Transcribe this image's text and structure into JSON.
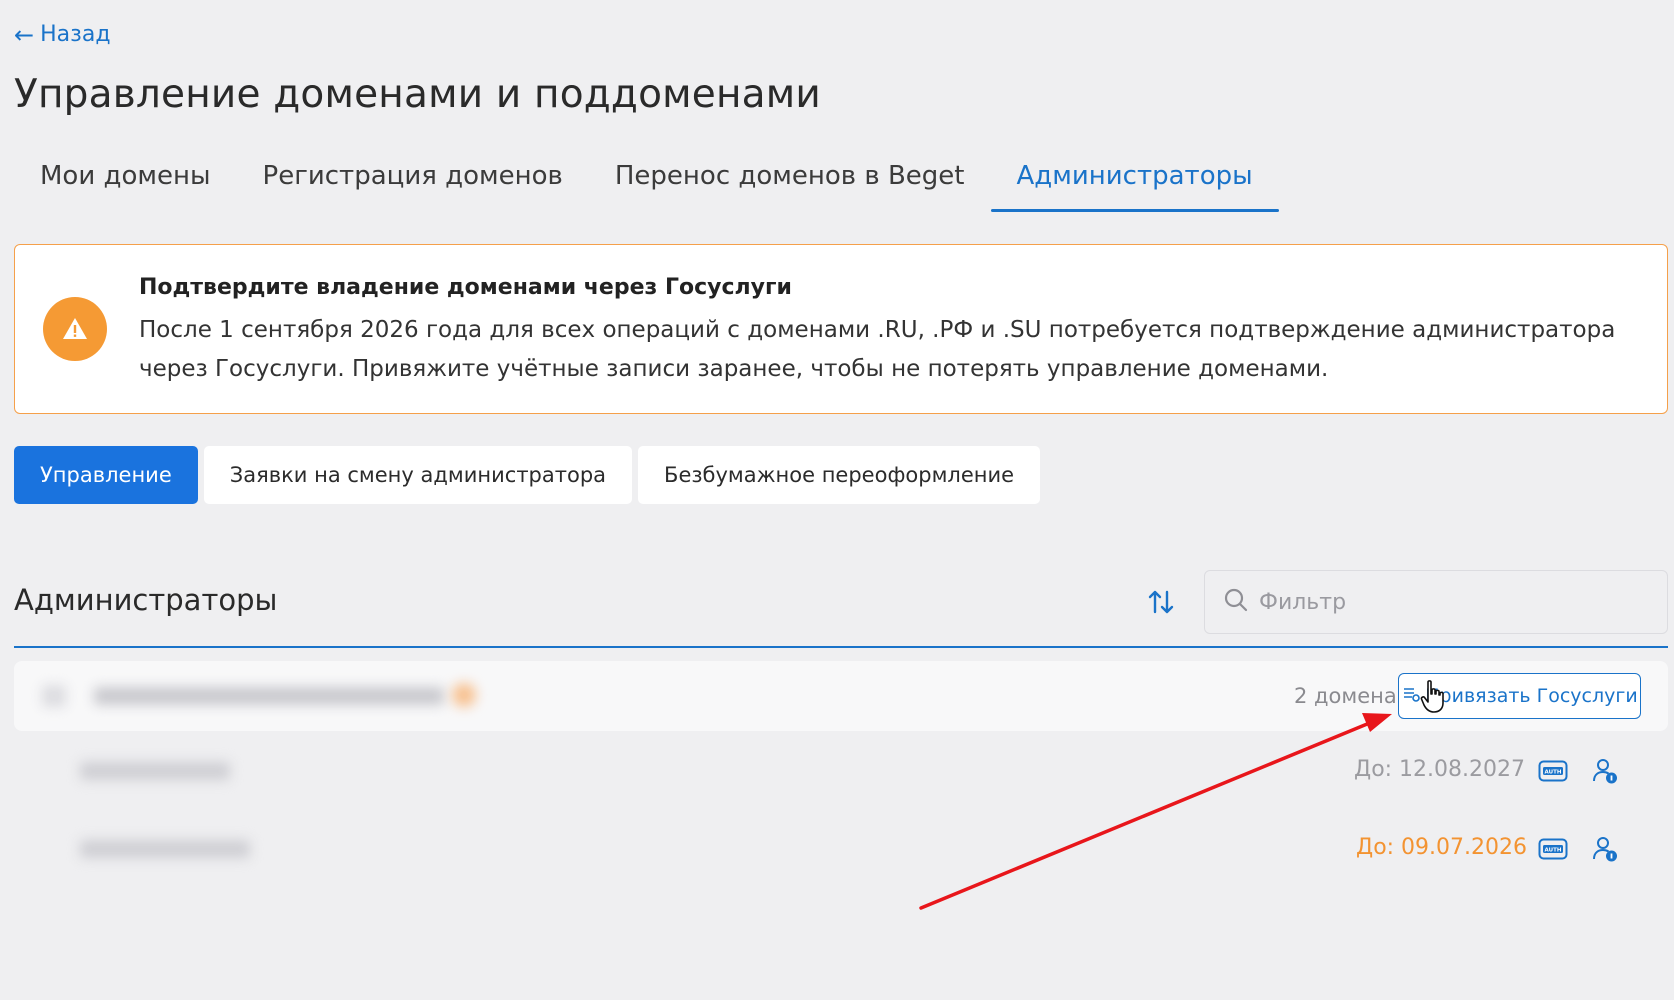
{
  "nav": {
    "back_label": "Назад"
  },
  "page": {
    "title": "Управление доменами и поддоменами"
  },
  "tabs": [
    {
      "label": "Мои домены"
    },
    {
      "label": "Регистрация доменов"
    },
    {
      "label": "Перенос доменов в Beget"
    },
    {
      "label": "Администраторы",
      "active": true
    }
  ],
  "alert": {
    "title": "Подтвердите владение доменами через Госуслуги",
    "body": "После 1 сентября 2026 года для всех операций с доменами .RU, .РФ и .SU потребуется подтверждение администратора через Госуслуги. Привяжите учётные записи заранее, чтобы не потерять управление доменами."
  },
  "segments": [
    {
      "label": "Управление",
      "active": true
    },
    {
      "label": "Заявки на смену администратора"
    },
    {
      "label": "Безбумажное переоформление"
    }
  ],
  "section": {
    "title": "Администраторы",
    "filter_placeholder": "Фильтр"
  },
  "admin_row": {
    "domains_count": "2 домена",
    "link_button": "Привязать Госуслуги"
  },
  "domain_rows": [
    {
      "expires": "До: 12.08.2027",
      "status": "normal"
    },
    {
      "expires": "До: 09.07.2026",
      "status": "warning"
    }
  ],
  "colors": {
    "accent": "#1a73c9",
    "warning": "#f39331",
    "annotation_arrow": "#e8161b"
  },
  "icons": [
    "arrow-left-icon",
    "warning-icon",
    "sort-icon",
    "search-icon",
    "gosuslugi-icon",
    "auth-icon",
    "user-info-icon",
    "hand-cursor-icon"
  ]
}
